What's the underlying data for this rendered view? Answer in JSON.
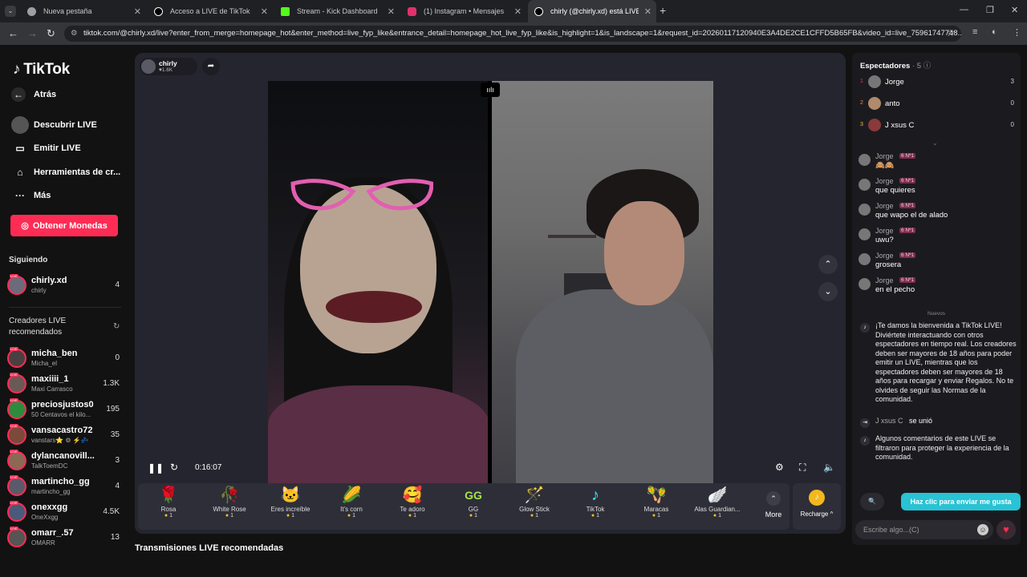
{
  "browser": {
    "tabs": [
      {
        "title": "Nueva pestaña",
        "color": "#9aa0a6"
      },
      {
        "title": "Acceso a LIVE de TikTok",
        "color": "#ffffff"
      },
      {
        "title": "Stream - Kick Dashboard",
        "color": "#53fc18"
      },
      {
        "title": "(1) Instagram • Mensajes",
        "color": "#e1306c"
      },
      {
        "title": "chirly (@chirly.xd) está LIVE",
        "color": "#ffffff"
      }
    ],
    "url": "tiktok.com/@chirly.xd/live?enter_from_merge=homepage_hot&enter_method=live_fyp_like&entrance_detail=homepage_hot_live_fyp_like&is_highlight=1&is_landscape=1&request_id=20260117120940E3A4DE2CE1CFFD5B65FB&video_id=live_75961747748..."
  },
  "sidebar": {
    "logo": "TikTok",
    "nav": [
      {
        "label": "Atrás",
        "icon": "arrow-left-icon"
      },
      {
        "label": "Descubrir LIVE",
        "icon": "discover-icon"
      },
      {
        "label": "Emitir LIVE",
        "icon": "camera-icon"
      },
      {
        "label": "Herramientas de cr...",
        "icon": "home-icon"
      },
      {
        "label": "Más",
        "icon": "more-icon"
      }
    ],
    "coins_button": "Obtener Monedas",
    "following_title": "Siguiendo",
    "following": [
      {
        "name": "chirly.xd",
        "sub": "chirly",
        "count": "4"
      }
    ],
    "recommended_title": "Creadores LIVE recomendados",
    "recommended": [
      {
        "name": "micha_ben",
        "sub": "Micha_el",
        "count": "0"
      },
      {
        "name": "maxiiii_1",
        "sub": "Maxi Carrasco",
        "count": "1.3K"
      },
      {
        "name": "preciosjustos0",
        "sub": "50 Centavos el kilo...",
        "count": "195"
      },
      {
        "name": "vansacastro72",
        "sub": "vanstars⭐ ⚙ ⚡💤",
        "count": "35"
      },
      {
        "name": "dylancanovill...",
        "sub": "TalkToemDC",
        "count": "3"
      },
      {
        "name": "martincho_gg",
        "sub": "martincho_gg",
        "count": "4"
      },
      {
        "name": "onexxgg",
        "sub": "OneXxgg",
        "count": "4.5K"
      },
      {
        "name": "omarr_.57",
        "sub": "OMARR",
        "count": "13"
      }
    ],
    "live_badge": "LIVE"
  },
  "stream": {
    "host_name": "chirly",
    "host_likes": "♥1.6K",
    "time": "0:16:07"
  },
  "gifts": [
    {
      "name": "Rosa",
      "price": "1",
      "icon": "🌹"
    },
    {
      "name": "White Rose",
      "price": "1",
      "icon": "🥀"
    },
    {
      "name": "Eres increíble",
      "price": "1",
      "icon": "🐱"
    },
    {
      "name": "It's corn",
      "price": "1",
      "icon": "🌽"
    },
    {
      "name": "Te adoro",
      "price": "1",
      "icon": "🥰"
    },
    {
      "name": "GG",
      "price": "1",
      "icon": "GG"
    },
    {
      "name": "Glow Stick",
      "price": "1",
      "icon": "🪄"
    },
    {
      "name": "TikTok",
      "price": "1",
      "icon": "♪"
    },
    {
      "name": "Maracas",
      "price": "1",
      "icon": "🪇"
    },
    {
      "name": "Alas Guardian...",
      "price": "1",
      "icon": "🪽"
    }
  ],
  "more_label": "More",
  "recharge_label": "Recharge ^",
  "recommended_streams_title": "Transmisiones LIVE recomendadas",
  "chat": {
    "title": "Espectadores",
    "count": "· 5",
    "viewers": [
      {
        "rank": "1",
        "name": "Jorge",
        "count": "3"
      },
      {
        "rank": "2",
        "name": "anto",
        "count": "0"
      },
      {
        "rank": "3",
        "name": "J xsus C",
        "count": "0"
      }
    ],
    "badge": "6 Nº1",
    "messages": [
      {
        "user": "Jorge",
        "text": "🙈🙈"
      },
      {
        "user": "Jorge",
        "text": "que quieres"
      },
      {
        "user": "Jorge",
        "text": "que wapo el de alado"
      },
      {
        "user": "Jorge",
        "text": "uwu?"
      },
      {
        "user": "Jorge",
        "text": "grosera"
      },
      {
        "user": "Jorge",
        "text": "en el pecho"
      }
    ],
    "new_label": "Nuevos",
    "welcome": "¡Te damos la bienvenida a TikTok LIVE! Diviértete interactuando con otros espectadores en tiempo real. Los creadores deben ser mayores de 18 años para poder emitir un LIVE, mientras que los espectadores deben ser mayores de 18 años para recargar y enviar Regalos. No te olvides de seguir las Normas de la comunidad.",
    "join_user": "J xsus C",
    "join_text": "se unió",
    "filter_notice": "Algunos comentarios de este LIVE se filtraron para proteger la experiencia de la comunidad.",
    "like_button": "Haz clic para enviar me gusta",
    "input_placeholder": "Escribe algo...(C)"
  }
}
